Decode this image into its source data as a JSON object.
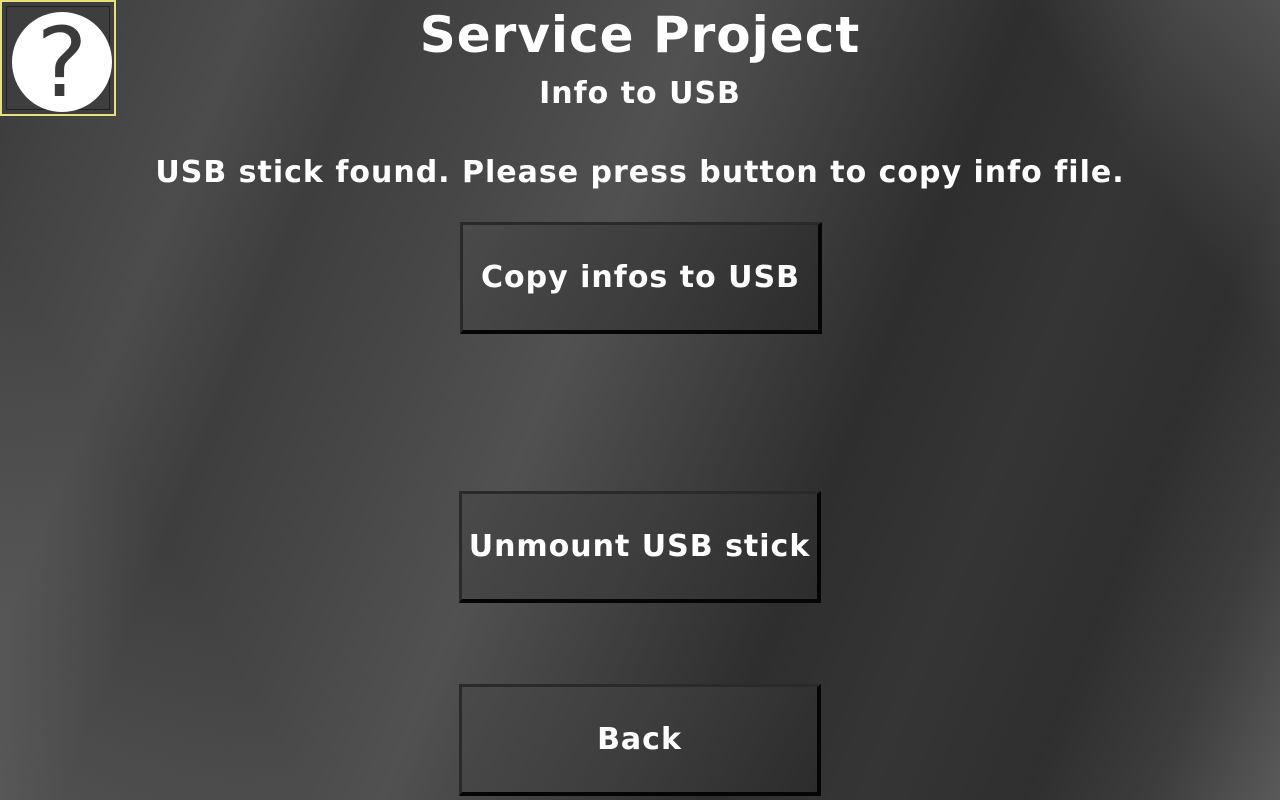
{
  "header": {
    "title": "Service Project",
    "subtitle": "Info to USB"
  },
  "message": "USB stick found. Please press button to copy info file.",
  "buttons": {
    "copy_label": "Copy infos to USB",
    "unmount_label": "Unmount USB stick",
    "back_label": "Back"
  },
  "help": {
    "icon": "question-mark-icon",
    "glyph": "?"
  },
  "colors": {
    "help_border": "#e8e07a",
    "text": "#ffffff"
  }
}
